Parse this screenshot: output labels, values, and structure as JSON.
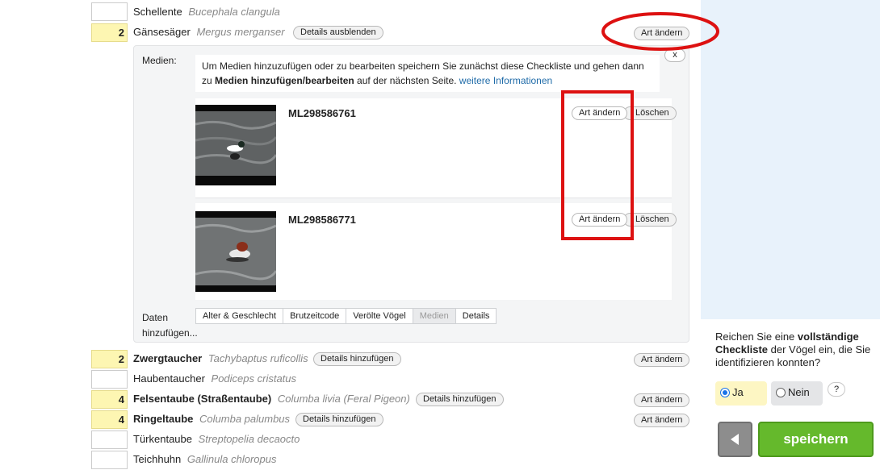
{
  "species": [
    {
      "count": "",
      "name": "Schellente",
      "sci": "Bucephala clangula"
    },
    {
      "count": "2",
      "name": "Gänsesäger",
      "sci": "Mergus merganser",
      "details_label": "Details ausblenden",
      "change_label": "Art ändern"
    },
    {
      "count": "2",
      "name": "Zwergtaucher",
      "sci": "Tachybaptus ruficollis",
      "details_label": "Details hinzufügen",
      "change_label": "Art ändern"
    },
    {
      "count": "",
      "name": "Haubentaucher",
      "sci": "Podiceps cristatus"
    },
    {
      "count": "4",
      "name": "Felsentaube (Straßentaube)",
      "sci": "Columba livia (Feral Pigeon)",
      "details_label": "Details hinzufügen",
      "change_label": "Art ändern"
    },
    {
      "count": "4",
      "name": "Ringeltaube",
      "sci": "Columba palumbus",
      "details_label": "Details hinzufügen",
      "change_label": "Art ändern"
    },
    {
      "count": "",
      "name": "Türkentaube",
      "sci": "Streptopelia decaocto"
    },
    {
      "count": "",
      "name": "Teichhuhn",
      "sci": "Gallinula chloropus"
    }
  ],
  "details_panel": {
    "media_label": "Medien:",
    "close_label": "x",
    "info_part1": "Um Medien hinzuzufügen oder zu bearbeiten speichern Sie zunächst diese Checkliste und gehen dann zu ",
    "info_bold": "Medien hinzufügen/bearbeiten",
    "info_part2": " auf der nächsten Seite. ",
    "info_link": "weitere Informationen",
    "media": [
      {
        "id": "ML298586761",
        "change_label": "Art ändern",
        "delete_label": "Löschen"
      },
      {
        "id": "ML298586771",
        "change_label": "Art ändern",
        "delete_label": "Löschen"
      }
    ],
    "add_data_label": "Daten hinzufügen...",
    "tabs": [
      "Alter & Geschlecht",
      "Brutzeitcode",
      "Verölte Vögel",
      "Medien",
      "Details"
    ],
    "active_tab": "Medien"
  },
  "sidebar": {
    "question_part1": "Reichen Sie eine ",
    "question_bold": "vollständige Checkliste",
    "question_part2": " der Vögel ein, die Sie identifizieren konnten?",
    "yes_label": "Ja",
    "no_label": "Nein",
    "help_label": "?",
    "save_label": "speichern",
    "selected": "Ja"
  },
  "colors": {
    "annotation_red": "#dd1111",
    "save_green": "#65b92c",
    "sidebar_blue": "#e8f2fb",
    "count_yellow": "#fdf6b2"
  }
}
